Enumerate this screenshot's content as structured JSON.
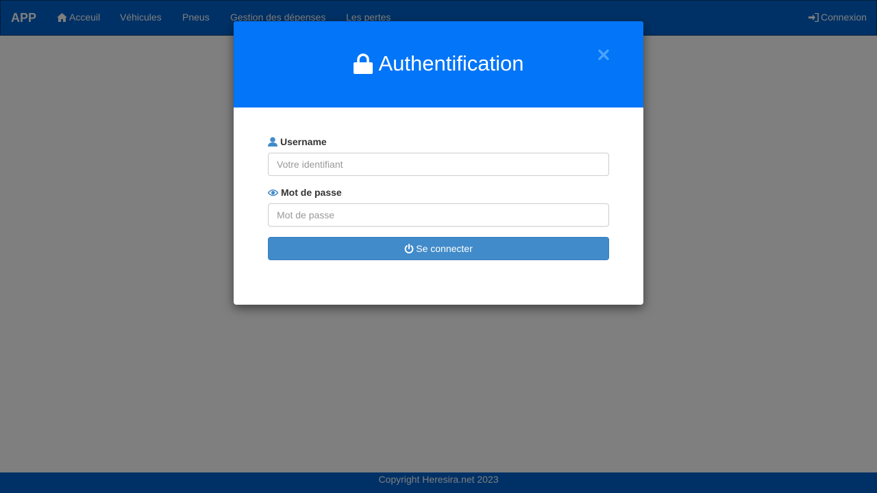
{
  "navbar": {
    "brand": "APP",
    "items": [
      {
        "label": "Acceuil",
        "icon": "home-icon"
      },
      {
        "label": "Véhicules"
      },
      {
        "label": "Pneus"
      },
      {
        "label": "Gestion des dépenses"
      },
      {
        "label": "Les pertes"
      }
    ],
    "login": {
      "label": "Connexion",
      "icon": "sign-in-icon"
    }
  },
  "footer": {
    "text": "Copyright Heresira.net 2023"
  },
  "modal": {
    "title": "Authentification",
    "title_icon": "lock-icon",
    "close_icon": "close-icon",
    "username": {
      "label": "Username",
      "icon": "user-icon",
      "placeholder": "Votre identifiant",
      "value": ""
    },
    "password": {
      "label": "Mot de passe",
      "icon": "eye-icon",
      "placeholder": "Mot de passe",
      "value": ""
    },
    "submit": {
      "label": "Se connecter",
      "icon": "power-icon"
    }
  },
  "colors": {
    "navbar": "#0062cc",
    "modal_header": "#0275f8",
    "button": "#428bca",
    "label_icon": "#428bca"
  }
}
